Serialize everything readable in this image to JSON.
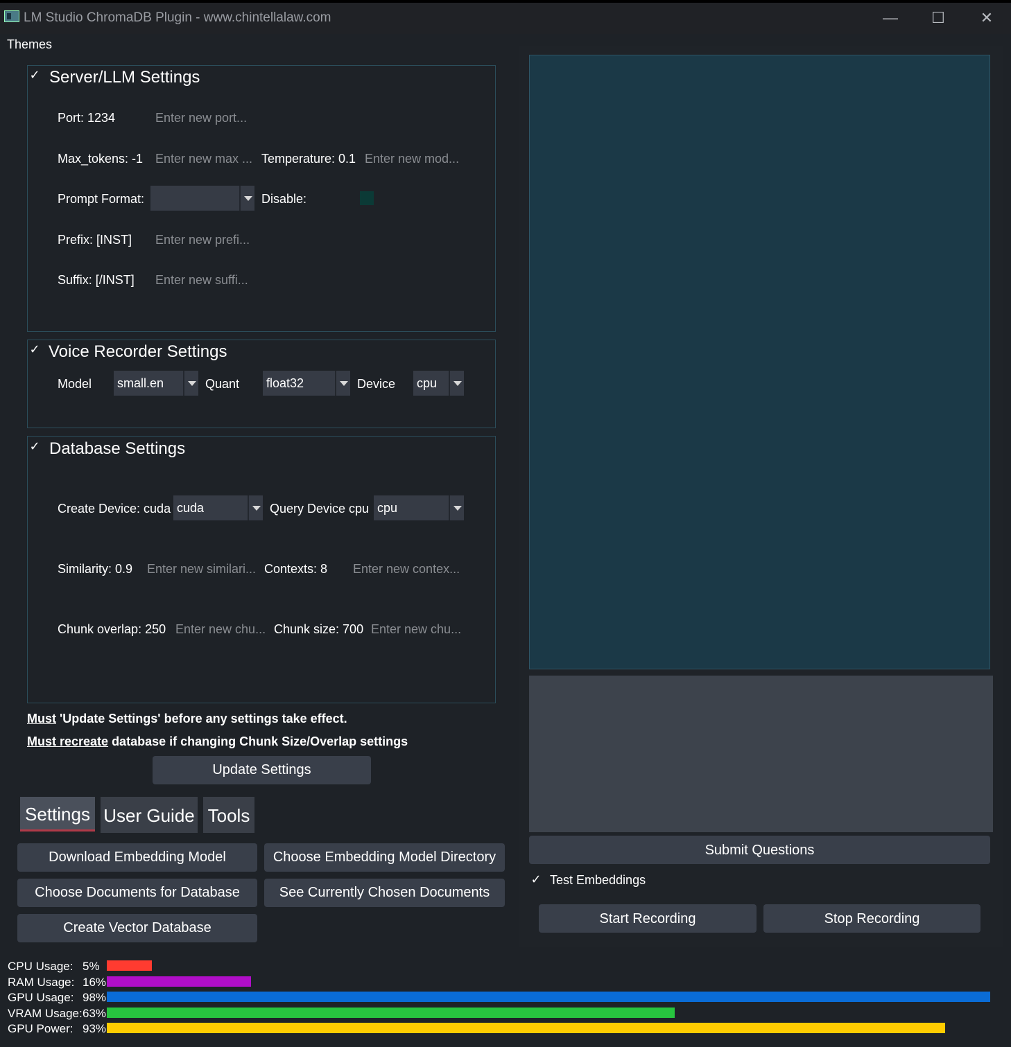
{
  "window": {
    "title": "LM Studio ChromaDB Plugin - www.chintellalaw.com",
    "minimize_glyph": "—",
    "maximize_glyph": "☐",
    "close_glyph": "✕"
  },
  "menubar": {
    "themes": "Themes"
  },
  "server_settings": {
    "title": "Server/LLM Settings",
    "port_label": "Port: 1234",
    "port_placeholder": "Enter new port...",
    "max_tokens_label": "Max_tokens: -1",
    "max_tokens_placeholder": "Enter new max ...",
    "temperature_label": "Temperature: 0.1",
    "temperature_placeholder": "Enter new mod...",
    "prompt_format_label": "Prompt Format:",
    "prompt_format_value": "",
    "disable_label": "Disable:",
    "prefix_label": "Prefix: [INST]",
    "prefix_placeholder": "Enter new prefi...",
    "suffix_label": "Suffix: [/INST]",
    "suffix_placeholder": "Enter new suffi..."
  },
  "voice_settings": {
    "title": "Voice Recorder Settings",
    "model_label": "Model",
    "model_value": "small.en",
    "quant_label": "Quant",
    "quant_value": "float32",
    "device_label": "Device",
    "device_value": "cpu"
  },
  "database_settings": {
    "title": "Database Settings",
    "create_device_label": "Create Device: cuda",
    "create_device_value": "cuda",
    "query_device_label": "Query Device cpu",
    "query_device_value": "cpu",
    "similarity_label": "Similarity: 0.9",
    "similarity_placeholder": "Enter new similari...",
    "contexts_label": "Contexts: 8",
    "contexts_placeholder": "Enter new contex...",
    "chunk_overlap_label": "Chunk overlap: 250",
    "chunk_overlap_placeholder": "Enter new chu...",
    "chunk_size_label": "Chunk size: 700",
    "chunk_size_placeholder": "Enter new chu..."
  },
  "notes": {
    "line1_emph": "Must",
    "line1_rest": " 'Update Settings' before any settings take effect.",
    "line2_emph": "Must recreate",
    "line2_rest": " database if changing Chunk Size/Overlap settings"
  },
  "update_button": "Update Settings",
  "tabs": [
    "Settings",
    "User Guide",
    "Tools"
  ],
  "tool_buttons": {
    "download_model": "Download Embedding Model",
    "choose_model_dir": "Choose Embedding Model Directory",
    "choose_docs": "Choose Documents for Database",
    "see_docs": "See Currently Chosen Documents",
    "create_db": "Create Vector Database"
  },
  "right_panel": {
    "submit": "Submit Questions",
    "test_embeddings": "Test Embeddings",
    "start_recording": "Start Recording",
    "stop_recording": "Stop Recording"
  },
  "metrics": [
    {
      "label": "CPU Usage:",
      "value": "5%",
      "percent": 5,
      "color": "#ff3b30"
    },
    {
      "label": "RAM Usage:",
      "value": "16%",
      "percent": 16,
      "color": "#b00ec8"
    },
    {
      "label": "GPU Usage:",
      "value": "98%",
      "percent": 98,
      "color": "#0a6cd6"
    },
    {
      "label": "VRAM Usage:",
      "value": "63%",
      "percent": 63,
      "color": "#27c53f"
    },
    {
      "label": "GPU Power:",
      "value": "93%",
      "percent": 93,
      "color": "#ffcc00"
    }
  ]
}
